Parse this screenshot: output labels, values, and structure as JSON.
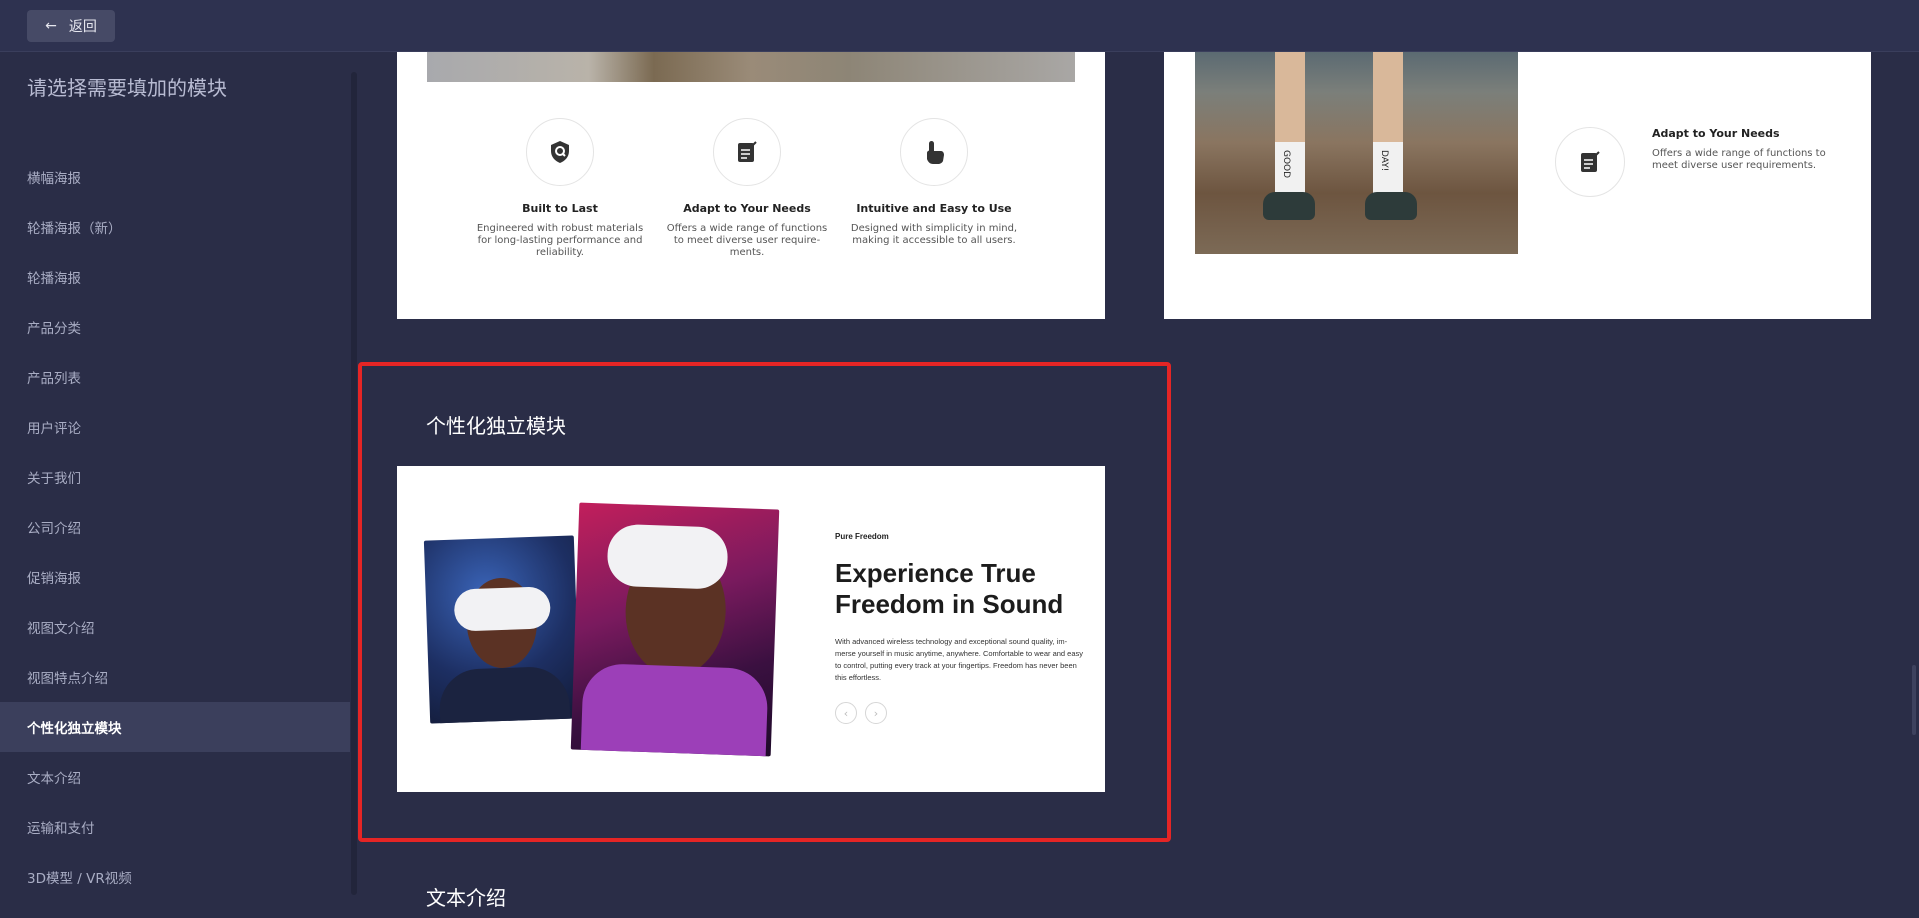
{
  "topbar": {
    "back_label": "返回"
  },
  "sidebar": {
    "title": "请选择需要填加的模块",
    "items": [
      {
        "label": "横幅海报"
      },
      {
        "label": "轮播海报（新）"
      },
      {
        "label": "轮播海报"
      },
      {
        "label": "产品分类"
      },
      {
        "label": "产品列表"
      },
      {
        "label": "用户评论"
      },
      {
        "label": "关于我们"
      },
      {
        "label": "公司介绍"
      },
      {
        "label": "促销海报"
      },
      {
        "label": "视图文介绍"
      },
      {
        "label": "视图特点介绍"
      },
      {
        "label": "个性化独立模块"
      },
      {
        "label": "文本介绍"
      },
      {
        "label": "运输和支付"
      },
      {
        "label": "3D模型 / VR视频"
      }
    ],
    "active_index": 11
  },
  "preview_a": {
    "features": [
      {
        "title": "Built to Last",
        "desc": "Engineered with robust materials for long-lasting performance and reliability.",
        "icon": "shield-icon"
      },
      {
        "title": "Adapt to Your Needs",
        "desc": "Offers a wide range of functions to meet diverse user require-ments.",
        "icon": "note-edit-icon"
      },
      {
        "title": "Intuitive and Easy to Use",
        "desc": "Designed with simplicity in mind, making it accessible to all users.",
        "icon": "hand-pointer-icon"
      }
    ]
  },
  "preview_b": {
    "feature": {
      "title": "Adapt to Your Needs",
      "desc": "Offers a wide range of functions to meet diverse user requirements.",
      "icon": "note-edit-icon"
    },
    "socks_text": [
      "GOOD",
      "DAY!"
    ]
  },
  "selected_module": {
    "title": "个性化独立模块",
    "kicker": "Pure Freedom",
    "headline": "Experience True Freedom in Sound",
    "body": "With advanced wireless technology and exceptional sound quality, im-merse yourself in music anytime, anywhere. Comfortable to wear and easy to control, putting every track at your fingertips. Freedom has never been this effortless.",
    "prev_icon": "chevron-left-icon",
    "next_icon": "chevron-right-icon"
  },
  "next_section": {
    "title": "文本介绍"
  },
  "colors": {
    "background": "#2a2d47",
    "highlight_border": "#e52525",
    "active_item": "#3b3f5c"
  }
}
